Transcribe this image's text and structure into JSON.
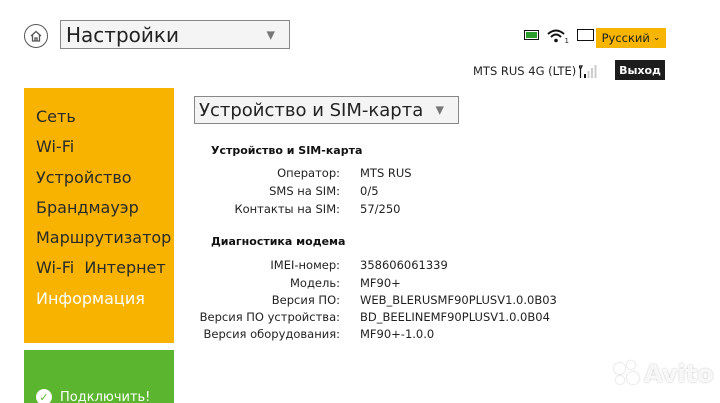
{
  "header": {
    "page_select": "Настройки",
    "language": "Русский",
    "network": "MTS RUS 4G (LTE)",
    "sim_badge": "1",
    "exit_label": "Выход"
  },
  "sidebar": {
    "items": [
      {
        "label": "Сеть"
      },
      {
        "label": "Wi-Fi"
      },
      {
        "label": "Устройство"
      },
      {
        "label": "Брандмауэр"
      },
      {
        "label": "Маршрутизатор"
      },
      {
        "label": "Wi-Fi  Интернет"
      },
      {
        "label": "Информация"
      }
    ],
    "active_index": 6,
    "connect_label": "Подключить!"
  },
  "main": {
    "section_select": "Устройство и SIM-карта",
    "sim_group": {
      "title": "Устройство и SIM-карта",
      "rows": [
        {
          "label": "Оператор:",
          "value": "MTS RUS"
        },
        {
          "label": "SMS на SIM:",
          "value": "0/5"
        },
        {
          "label": "Контакты на SIM:",
          "value": "57/250"
        }
      ]
    },
    "diag_group": {
      "title": "Диагностика модема",
      "rows": [
        {
          "label": "IMEI-номер:",
          "value": "358606061339"
        },
        {
          "label": "Модель:",
          "value": "MF90+"
        },
        {
          "label": "Версия ПО:",
          "value": "WEB_BLERUSMF90PLUSV1.0.0B03"
        },
        {
          "label": "Версия ПО устройства:",
          "value": "BD_BEELINEMF90PLUSV1.0.0B04"
        },
        {
          "label": "Версия оборудования:",
          "value": "MF90+-1.0.0"
        }
      ]
    }
  },
  "watermark": "Avito",
  "colors": {
    "accent": "#f7b300",
    "connect": "#5bb52e",
    "exit": "#1d1d1d",
    "battery": "#2c9c2c"
  },
  "icons": [
    "home-icon",
    "battery-icon",
    "wifi-icon",
    "battery-empty-icon",
    "signal-icon",
    "check-icon",
    "chevron-down-icon"
  ]
}
